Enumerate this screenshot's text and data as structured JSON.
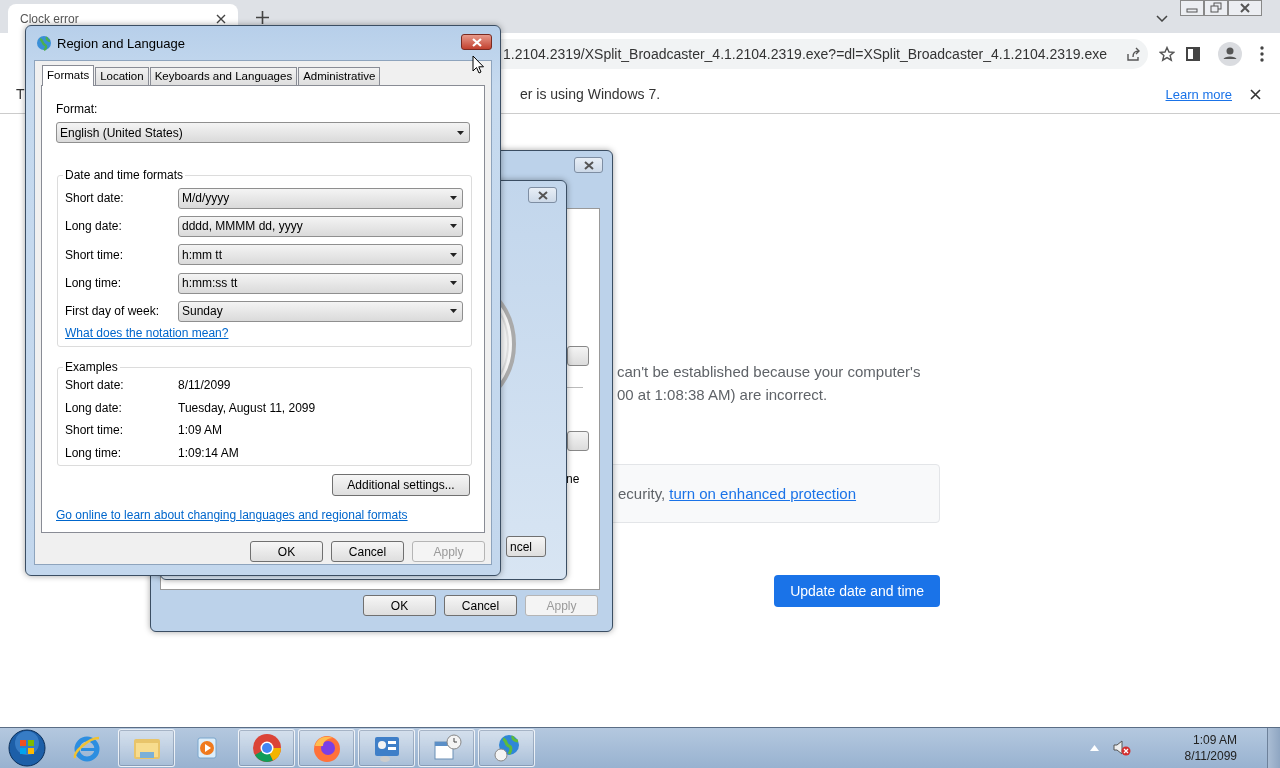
{
  "browser": {
    "tab": {
      "title": "Clock error"
    },
    "address": {
      "value": "1.2104.2319/XSplit_Broadcaster_4.1.2104.2319.exe?=dl=XSplit_Broadcaster_4.1.2104.2319.exe"
    },
    "infobar": {
      "text_start": "T",
      "text_end": "er is using Windows 7.",
      "link": "Learn more"
    },
    "error": {
      "line_1": "can't be established because your computer's",
      "line_2": "00 at 1:08:38 AM) are incorrect.",
      "notice": "ecurity,",
      "notice_link": "turn on enhanced protection",
      "button": "Update date and time"
    }
  },
  "back_dialog": {
    "text_fragment": "ne",
    "buttons": [
      {
        "label": "OK",
        "disabled": false
      },
      {
        "label": "Cancel",
        "disabled": false
      },
      {
        "label": "Apply",
        "disabled": true
      }
    ]
  },
  "middle_dialog": {
    "button": "ncel"
  },
  "dialog": {
    "title": "Region and Language",
    "tabs": [
      {
        "label": "Formats",
        "selected": true
      },
      {
        "label": "Location",
        "selected": false
      },
      {
        "label": "Keyboards and Languages",
        "selected": false
      },
      {
        "label": "Administrative",
        "selected": false
      }
    ],
    "format_label": "Format:",
    "format_value": "English (United States)",
    "group_title": "Date and time formats",
    "formats": [
      {
        "label": "Short date:",
        "value": "M/d/yyyy"
      },
      {
        "label": "Long date:",
        "value": "dddd, MMMM dd, yyyy"
      },
      {
        "label": "Short time:",
        "value": "h:mm tt"
      },
      {
        "label": "Long time:",
        "value": "h:mm:ss tt"
      },
      {
        "label": "First day of week:",
        "value": "Sunday"
      }
    ],
    "notation_link": "What does the notation mean?",
    "examples_title": "Examples",
    "examples": [
      {
        "label": "Short date:",
        "value": "8/11/2099"
      },
      {
        "label": "Long date:",
        "value": "Tuesday, August 11, 2099"
      },
      {
        "label": "Short time:",
        "value": "1:09 AM"
      },
      {
        "label": "Long time:",
        "value": "1:09:14 AM"
      }
    ],
    "additional_button": "Additional settings...",
    "online_link": "Go online to learn about changing languages and regional formats",
    "buttons": [
      {
        "label": "OK",
        "disabled": false
      },
      {
        "label": "Cancel",
        "disabled": false
      },
      {
        "label": "Apply",
        "disabled": true
      }
    ]
  },
  "taskbar": {
    "apps": [
      {
        "kind": "ie",
        "running": false
      },
      {
        "kind": "explorer",
        "running": true
      },
      {
        "kind": "media",
        "running": false
      },
      {
        "kind": "chrome",
        "running": true
      },
      {
        "kind": "firefox",
        "running": true
      },
      {
        "kind": "control",
        "running": true
      },
      {
        "kind": "calendar",
        "running": true
      },
      {
        "kind": "globe",
        "running": true
      }
    ],
    "clock": {
      "time": "1:09 AM",
      "date": "8/11/2099"
    }
  }
}
